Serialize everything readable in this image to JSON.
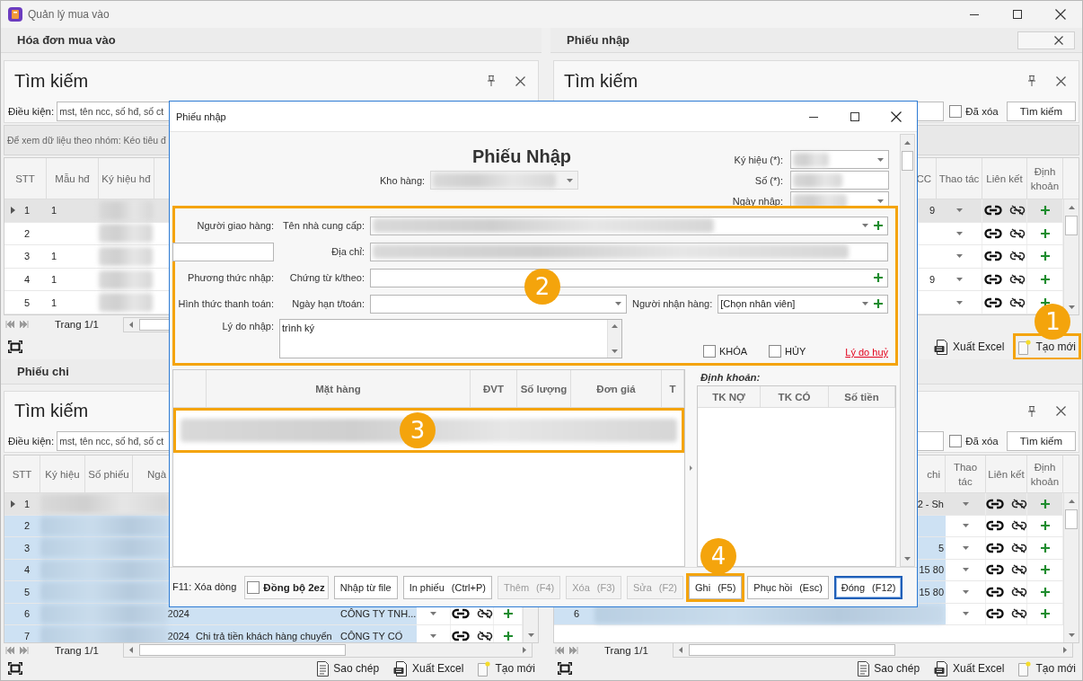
{
  "app": {
    "title": "Quản lý mua vào"
  },
  "panels": [
    {
      "title": "Hóa đơn mua vào",
      "search": {
        "title": "Tìm kiếm",
        "tools": true,
        "condition_label": "Điều kiện:",
        "placeholder": "mst, tên ncc, số hđ, số ct"
      },
      "group_bar": true,
      "group_hint": "Để xem dữ liệu theo nhóm: Kéo tiêu đ",
      "columns": [
        "STT",
        "Mẫu hđ",
        "Ký hiệu hđ"
      ],
      "rows": [
        {
          "stt": "1",
          "selected": true,
          "highlighted": false,
          "blurred": true,
          "cells": {
            "column_2": "1"
          }
        },
        {
          "stt": "2",
          "selected": false,
          "highlighted": false,
          "blurred": true
        },
        {
          "stt": "3",
          "selected": false,
          "highlighted": false,
          "blurred": true,
          "cells": {
            "column_2": "1"
          }
        },
        {
          "stt": "4",
          "selected": false,
          "highlighted": false,
          "blurred": true,
          "cells": {
            "column_2": "1"
          }
        },
        {
          "stt": "5",
          "selected": false,
          "highlighted": false,
          "blurred": true,
          "cells": {
            "column_2": "1"
          }
        }
      ],
      "pager": "Trang 1/1",
      "toolbar": [
        {
          "kind": "fit"
        }
      ]
    },
    {
      "title": "Phiếu nhập",
      "close_box": true,
      "search": {
        "title": "Tìm kiếm",
        "tools": true,
        "deleted": {
          "label": "Đã xóa",
          "checked": false
        },
        "button": "Tìm kiếm"
      },
      "group_bar": true,
      "columns": [
        "CC",
        "Thao tác",
        "Liên kết",
        "Định khoản"
      ],
      "rows": [
        {
          "selected": true,
          "highlighted": false,
          "actions": true,
          "cells": {
            "column_2": "9"
          }
        },
        {
          "selected": false,
          "highlighted": false,
          "actions": true
        },
        {
          "selected": false,
          "highlighted": false,
          "actions": true
        },
        {
          "selected": false,
          "highlighted": false,
          "actions": true,
          "cells": {
            "column_2": "9"
          }
        },
        {
          "selected": false,
          "highlighted": false,
          "actions": true
        }
      ],
      "toolbar": [
        {
          "kind": "export",
          "label": "Xuất Excel"
        },
        {
          "kind": "new",
          "label": "Tạo mới",
          "highlighted": true,
          "callout": "1"
        }
      ]
    },
    {
      "title": "Phiếu chi",
      "search": {
        "title": "Tìm kiếm",
        "tools": false,
        "condition_label": "Điều kiện:",
        "placeholder": "mst, tên ncc, số hđ, số ct"
      },
      "group_bar": false,
      "columns": [
        "STT",
        "Ký hiệu",
        "Số phiếu",
        "Ngà"
      ],
      "rows": [
        {
          "stt": "1",
          "selected": true,
          "highlighted": false,
          "blurred": true,
          "actions": false
        },
        {
          "stt": "2",
          "selected": false,
          "highlighted": true,
          "blurred": true,
          "actions": false
        },
        {
          "stt": "3",
          "selected": false,
          "highlighted": true,
          "blurred": true,
          "actions": false
        },
        {
          "stt": "4",
          "selected": false,
          "highlighted": true,
          "blurred": true,
          "actions": false
        },
        {
          "stt": "5",
          "selected": false,
          "highlighted": true,
          "blurred": true,
          "actions": false
        },
        {
          "stt": "6",
          "selected": false,
          "highlighted": true,
          "blurred": true,
          "actions": true,
          "cells": {
            "column_4": "2024",
            "column_6": "CÔNG TY TNH..."
          }
        },
        {
          "stt": "7",
          "selected": false,
          "highlighted": true,
          "blurred": true,
          "actions": true,
          "cells": {
            "column_4": "2024",
            "column_5": "Chi trả tiền khách hàng chuyển",
            "column_6": "CÔNG TY CỔ"
          }
        }
      ],
      "pager": "Trang 1/1",
      "toolbar": [
        {
          "kind": "fit"
        },
        {
          "kind": "copy",
          "label": "Sao chép"
        },
        {
          "kind": "export",
          "label": "Xuất Excel"
        },
        {
          "kind": "new",
          "label": "Tạo mới"
        }
      ]
    },
    {
      "search": {
        "tools": true,
        "deleted": {
          "label": "Đã xóa",
          "checked": false
        },
        "button": "Tìm kiếm"
      },
      "group_bar": false,
      "columns": [
        "chi",
        "Thao tác",
        "Liên kết",
        "Định khoản"
      ],
      "rows": [
        {
          "selected": true,
          "highlighted": false,
          "blurred": false,
          "actions": true,
          "cells": {
            "column_3": "2 - Sh"
          }
        },
        {
          "selected": false,
          "highlighted": true,
          "blurred": false,
          "actions": true
        },
        {
          "selected": false,
          "highlighted": true,
          "blurred": false,
          "actions": true,
          "cells": {
            "column_3": "5"
          }
        },
        {
          "selected": false,
          "highlighted": true,
          "blurred": false,
          "actions": true,
          "cells": {
            "column_3": "15 80"
          }
        },
        {
          "selected": false,
          "highlighted": true,
          "blurred": false,
          "actions": true,
          "cells": {
            "column_3": "15 80"
          }
        },
        {
          "stt": "6",
          "selected": false,
          "highlighted": true,
          "blurred": true,
          "actions": true
        }
      ],
      "pager": "Trang 1/1",
      "toolbar": [
        {
          "kind": "fit"
        },
        {
          "kind": "copy",
          "label": "Sao chép"
        },
        {
          "kind": "export",
          "label": "Xuất Excel"
        },
        {
          "kind": "new",
          "label": "Tạo mới"
        }
      ]
    }
  ],
  "dialog": {
    "title": "Phiếu nhập",
    "heading": "Phiếu Nhập",
    "warehouse": {
      "label": "Kho hàng:",
      "blurred": true,
      "disabled": true
    },
    "header_fields": [
      {
        "label": "Ký hiệu (*):",
        "kind": "combo",
        "blurred": true
      },
      {
        "label": "Số (*):",
        "kind": "text",
        "blurred": true
      },
      {
        "label": "Ngày nhập:",
        "kind": "combo",
        "blurred": true
      }
    ],
    "section": {
      "highlighted": true,
      "callout": "2",
      "deliverer": {
        "label": "Người giao hàng:"
      },
      "supplier": {
        "label": "Tên nhà cung cấp:",
        "blurred": true
      },
      "address": {
        "label": "Địa chỉ:",
        "blurred": true
      },
      "method": {
        "label": "Phương thức nhập:"
      },
      "attached": {
        "label": "Chứng từ k/theo:"
      },
      "payment": {
        "label": "Hình thức thanh toán:"
      },
      "due": {
        "label": "Ngày hạn t/toán:"
      },
      "receiver": {
        "label": "Người nhận hàng:",
        "value": "[Chọn nhân viên]"
      },
      "reason": {
        "label": "Lý do nhập:",
        "value": "trình ký"
      },
      "flags": [
        {
          "label": "KHÓA",
          "checked": false
        },
        {
          "label": "HỦY",
          "checked": false
        }
      ],
      "cancel_reason": "Lý do huỷ"
    },
    "items": {
      "columns": [
        "Mặt hàng",
        "ĐVT",
        "Số lượng",
        "Đơn giá",
        "T"
      ],
      "rows": [
        {
          "blurred": true,
          "highlighted": true,
          "callout": "3"
        }
      ]
    },
    "accounting": {
      "title": "Định khoản:",
      "columns": [
        "TK NỢ",
        "TK CÓ",
        "Số tiền"
      ]
    },
    "footer": {
      "hint": "F11: Xóa dòng",
      "sync": {
        "label": "Đồng bộ 2ez",
        "checked": false
      },
      "buttons": [
        {
          "label": "Nhập từ file",
          "disabled": false
        },
        {
          "label": "In phiếu",
          "shortcut": "(Ctrl+P)",
          "disabled": false
        },
        {
          "label": "Thêm",
          "shortcut": "(F4)",
          "disabled": true
        },
        {
          "label": "Xóa",
          "shortcut": "(F3)",
          "disabled": true
        },
        {
          "label": "Sửa",
          "shortcut": "(F2)",
          "disabled": true
        },
        {
          "label": "Ghi",
          "shortcut": "(F5)",
          "highlighted": true,
          "callout": "4"
        },
        {
          "label": "Phục hồi",
          "shortcut": "(Esc)",
          "disabled": false
        },
        {
          "label": "Đóng",
          "shortcut": "(F12)",
          "focused": true
        }
      ]
    }
  }
}
